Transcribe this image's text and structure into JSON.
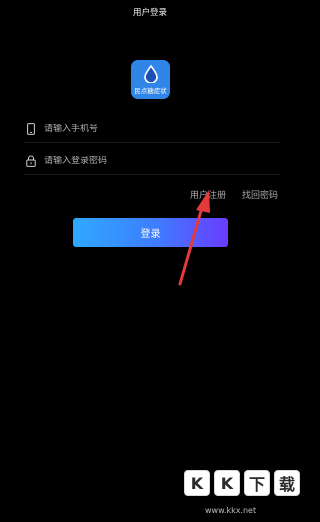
{
  "header": {
    "title": "用户登录"
  },
  "logo": {
    "label": "民点糖症状"
  },
  "form": {
    "phone": {
      "placeholder": "请输入手机号",
      "value": ""
    },
    "password": {
      "placeholder": "请输入登录密码",
      "value": ""
    }
  },
  "links": {
    "register": "用户注册",
    "forgot": "找回密码"
  },
  "login_button": {
    "label": "登录"
  },
  "colors": {
    "background": "#000000",
    "logo_blue": "#2f86e8",
    "arrow_red": "#e43a3a"
  },
  "icons": {
    "phone": "phone-icon",
    "lock": "lock-icon",
    "logo_drop": "water-drop-icon"
  },
  "watermark": {
    "letters": [
      "K",
      "K",
      "下",
      "载"
    ],
    "url": "www.kkx.net"
  }
}
